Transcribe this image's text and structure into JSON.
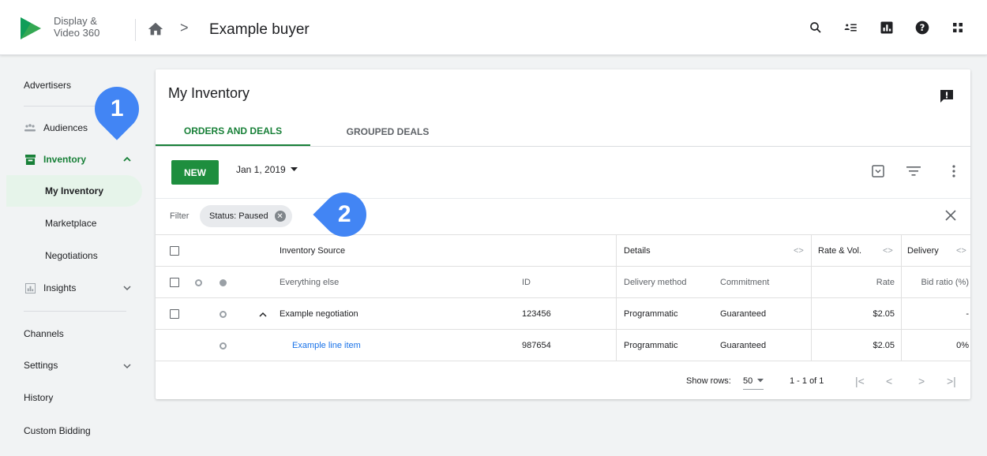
{
  "app": {
    "product_name_line1": "Display &",
    "product_name_line2": "Video 360",
    "breadcrumb_separator": ">",
    "breadcrumb_title": "Example buyer",
    "icons": [
      "search-icon",
      "tasks-icon",
      "reports-icon",
      "help-icon",
      "apps-icon"
    ]
  },
  "nav": {
    "advertisers": "Advertisers",
    "audiences": "Audiences",
    "inventory": "Inventory",
    "my_inventory": "My Inventory",
    "marketplace": "Marketplace",
    "negotiations": "Negotiations",
    "insights": "Insights",
    "channels": "Channels",
    "settings": "Settings",
    "history": "History",
    "custom_bidding": "Custom Bidding"
  },
  "callouts": {
    "one": "1",
    "two": "2"
  },
  "card": {
    "title": "My Inventory",
    "tabs": {
      "orders": "ORDERS AND DEALS",
      "grouped": "GROUPED DEALS"
    },
    "new_label": "NEW",
    "date": "Jan 1, 2019",
    "filter_label": "Filter",
    "filter_chip": "Status: Paused"
  },
  "table": {
    "group_headers": {
      "inventory_source": "Inventory Source",
      "details": "Details",
      "rate_vol": "Rate & Vol.",
      "delivery": "Delivery"
    },
    "col_headers": {
      "name": "Everything else",
      "id": "ID",
      "delivery_method": "Delivery method",
      "commitment": "Commitment",
      "rate": "Rate",
      "bid_ratio": "Bid ratio (%)"
    },
    "rows": [
      {
        "name": "Example negotiation",
        "id": "123456",
        "delivery_method": "Programmatic",
        "commitment": "Guaranteed",
        "rate": "$2.05",
        "bid_ratio": "-"
      },
      {
        "name": "Example line item",
        "id": "987654",
        "delivery_method": "Programmatic",
        "commitment": "Guaranteed",
        "rate": "$2.05",
        "bid_ratio": "0%"
      }
    ]
  },
  "footer": {
    "show_rows_label": "Show rows:",
    "rows_value": "50",
    "range": "1 - 1 of 1"
  },
  "colors": {
    "accent": "#188038",
    "callout": "#4285f4",
    "link": "#1a73e8"
  }
}
